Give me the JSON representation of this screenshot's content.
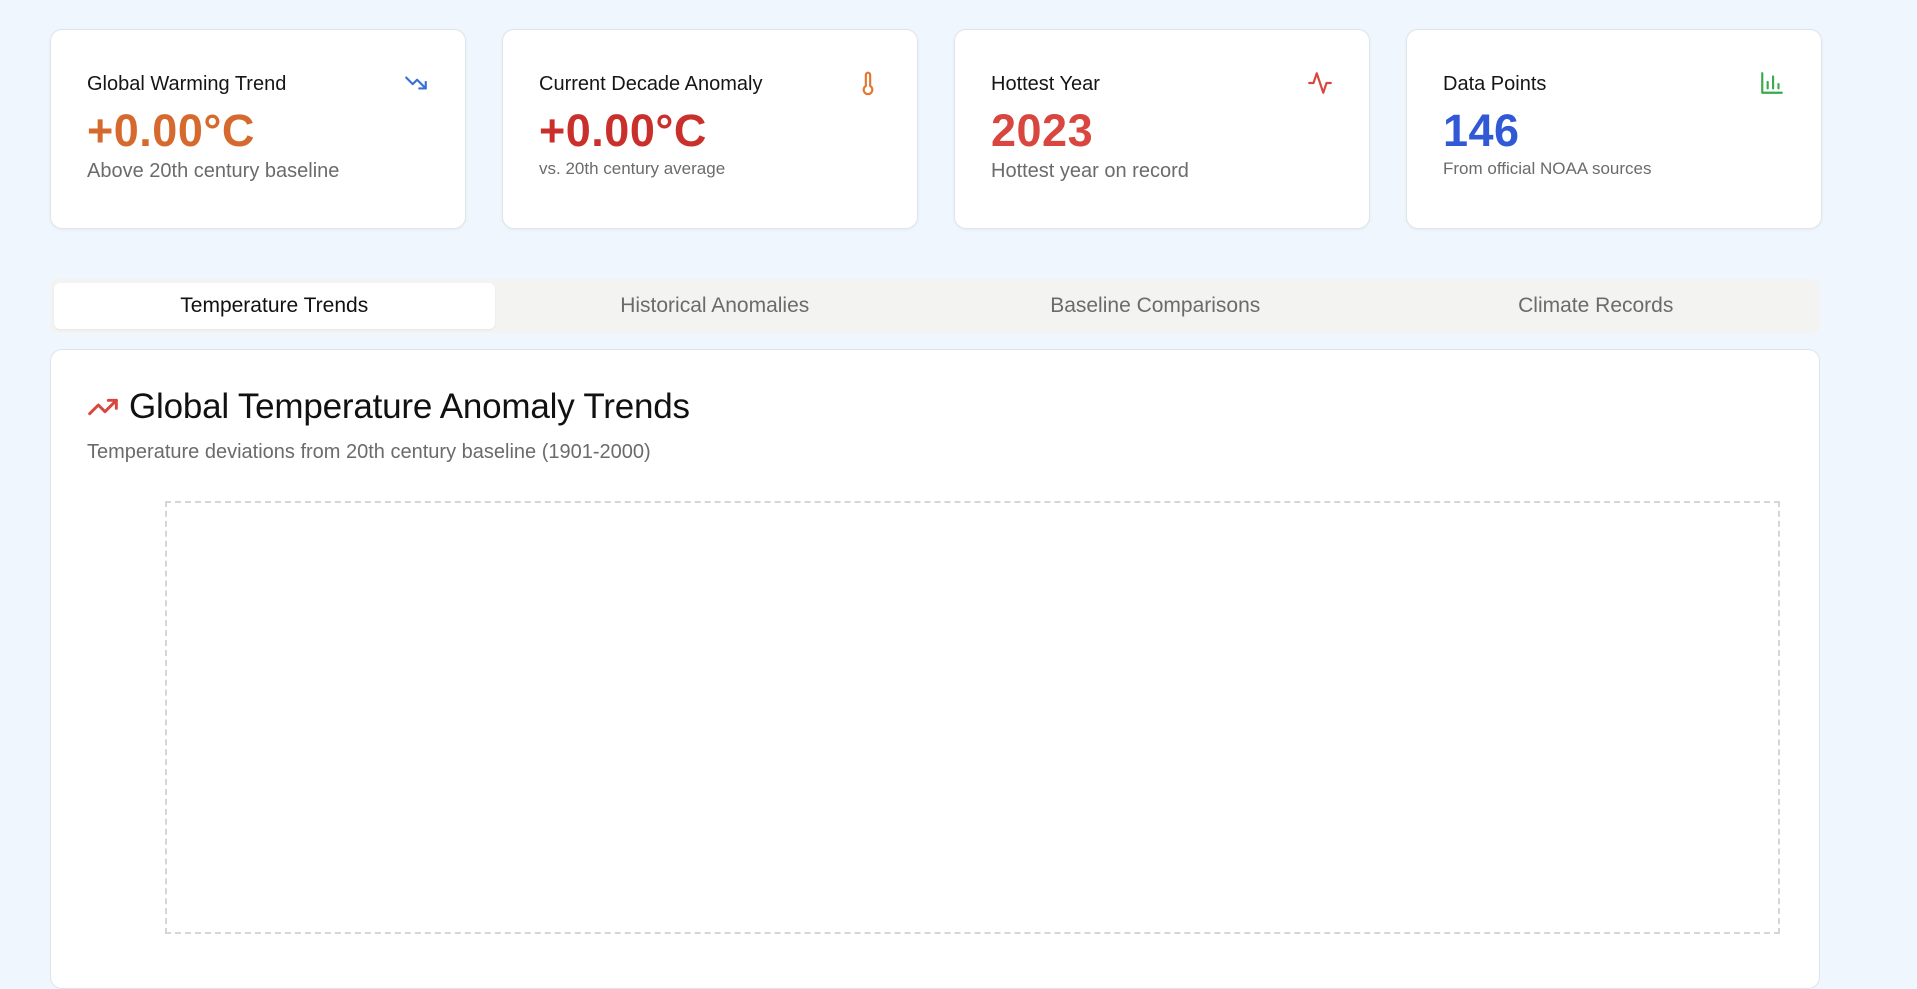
{
  "stats": [
    {
      "title": "Global Warming Trend",
      "value": "+0.00°C",
      "sub": "Above 20th century baseline",
      "icon": "trending-down-icon",
      "color": "#d66a2e",
      "icon_color": "#3b6fd8"
    },
    {
      "title": "Current Decade Anomaly",
      "value": "+0.00°C",
      "sub": "vs. 20th century average",
      "icon": "thermometer-icon",
      "color": "#c9302c",
      "icon_color": "#e5762f"
    },
    {
      "title": "Hottest Year",
      "value": "2023",
      "sub": "Hottest year on record",
      "icon": "activity-icon",
      "color": "#d9463f",
      "icon_color": "#d9463f"
    },
    {
      "title": "Data Points",
      "value": "146",
      "sub": "From official NOAA sources",
      "icon": "bar-chart-icon",
      "color": "#3159d6",
      "icon_color": "#3aaa4d"
    }
  ],
  "tabs": [
    {
      "label": "Temperature Trends",
      "active": true
    },
    {
      "label": "Historical Anomalies",
      "active": false
    },
    {
      "label": "Baseline Comparisons",
      "active": false
    },
    {
      "label": "Climate Records",
      "active": false
    }
  ],
  "panel": {
    "icon": "trending-up-icon",
    "icon_color": "#d9463f",
    "title": "Global Temperature Anomaly Trends",
    "subtitle": "Temperature deviations from 20th century baseline (1901-2000)"
  }
}
